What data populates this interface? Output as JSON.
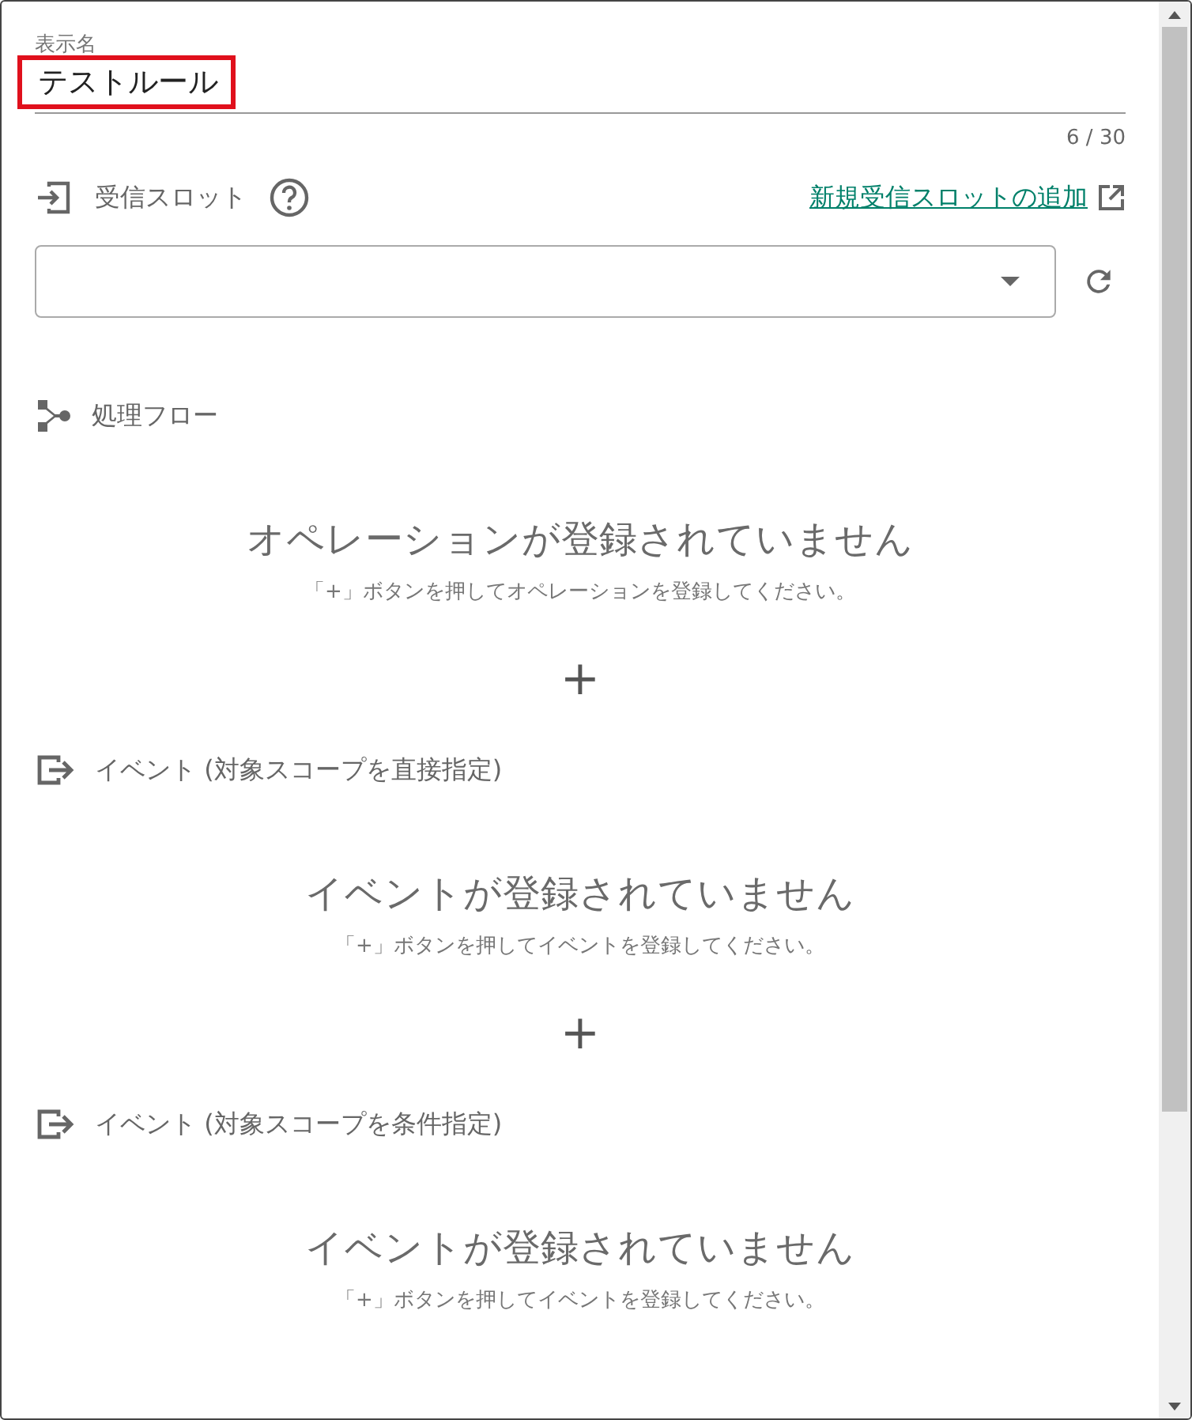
{
  "name_field": {
    "label": "表示名",
    "value": "テストルール",
    "highlighted": true,
    "counter": "6 / 30"
  },
  "slot": {
    "label": "受信スロット",
    "add_link": "新規受信スロットの追加"
  },
  "sections": [
    {
      "kind": "flow",
      "title": "処理フロー",
      "empty_title": "オペレーションが登録されていません",
      "empty_hint": "「+」ボタンを押してオペレーションを登録してください。",
      "add_button": "+"
    },
    {
      "kind": "event",
      "title": "イベント (対象スコープを直接指定)",
      "empty_title": "イベントが登録されていません",
      "empty_hint": "「+」ボタンを押してイベントを登録してください。",
      "add_button": "+"
    },
    {
      "kind": "event",
      "title": "イベント (対象スコープを条件指定)",
      "empty_title": "イベントが登録されていません",
      "empty_hint": "「+」ボタンを押してイベントを登録してください。"
    }
  ]
}
